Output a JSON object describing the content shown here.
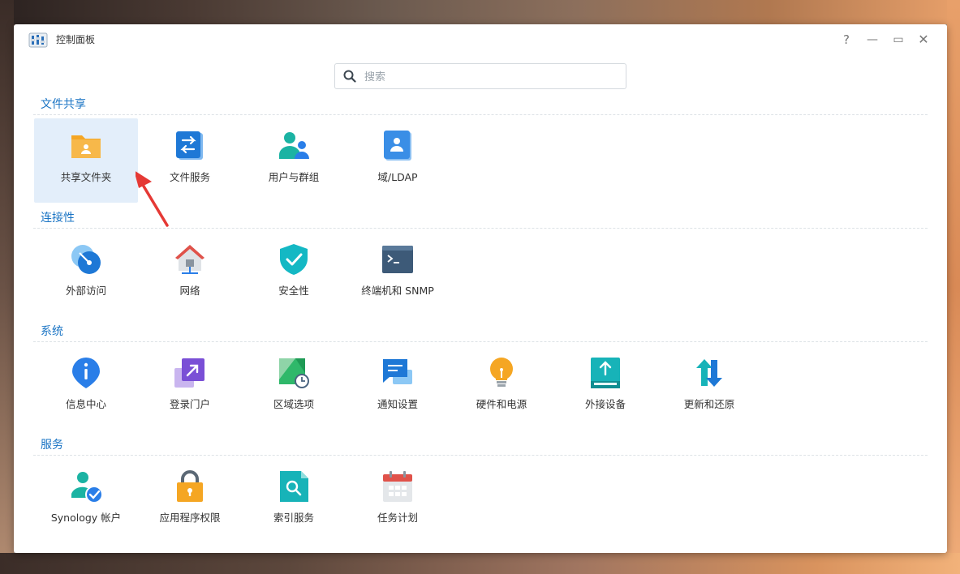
{
  "window": {
    "title": "控制面板",
    "help_label": "?",
    "minimize_label": "—",
    "maximize_label": "▭",
    "close_label": "✕"
  },
  "search": {
    "placeholder": "搜索",
    "value": ""
  },
  "sections": [
    {
      "title": "文件共享",
      "items": [
        {
          "label": "共享文件夹",
          "icon": "shared-folder-icon",
          "selected": true
        },
        {
          "label": "文件服务",
          "icon": "file-services-icon"
        },
        {
          "label": "用户与群组",
          "icon": "user-group-icon"
        },
        {
          "label": "域/LDAP",
          "icon": "domain-ldap-icon"
        }
      ]
    },
    {
      "title": "连接性",
      "items": [
        {
          "label": "外部访问",
          "icon": "external-access-icon"
        },
        {
          "label": "网络",
          "icon": "network-icon"
        },
        {
          "label": "安全性",
          "icon": "security-icon"
        },
        {
          "label": "终端机和 SNMP",
          "icon": "terminal-snmp-icon"
        }
      ]
    },
    {
      "title": "系统",
      "items": [
        {
          "label": "信息中心",
          "icon": "info-center-icon"
        },
        {
          "label": "登录门户",
          "icon": "login-portal-icon"
        },
        {
          "label": "区域选项",
          "icon": "regional-options-icon"
        },
        {
          "label": "通知设置",
          "icon": "notification-icon"
        },
        {
          "label": "硬件和电源",
          "icon": "hardware-power-icon"
        },
        {
          "label": "外接设备",
          "icon": "external-devices-icon"
        },
        {
          "label": "更新和还原",
          "icon": "update-restore-icon"
        }
      ]
    },
    {
      "title": "服务",
      "items": [
        {
          "label": "Synology 帐户",
          "icon": "synology-account-icon"
        },
        {
          "label": "应用程序权限",
          "icon": "app-privileges-icon"
        },
        {
          "label": "索引服务",
          "icon": "indexing-service-icon"
        },
        {
          "label": "任务计划",
          "icon": "task-scheduler-icon"
        }
      ]
    }
  ],
  "colors": {
    "accent": "#1a74c4",
    "selected_bg": "#e3eefa",
    "annotation_arrow": "#e53935"
  }
}
